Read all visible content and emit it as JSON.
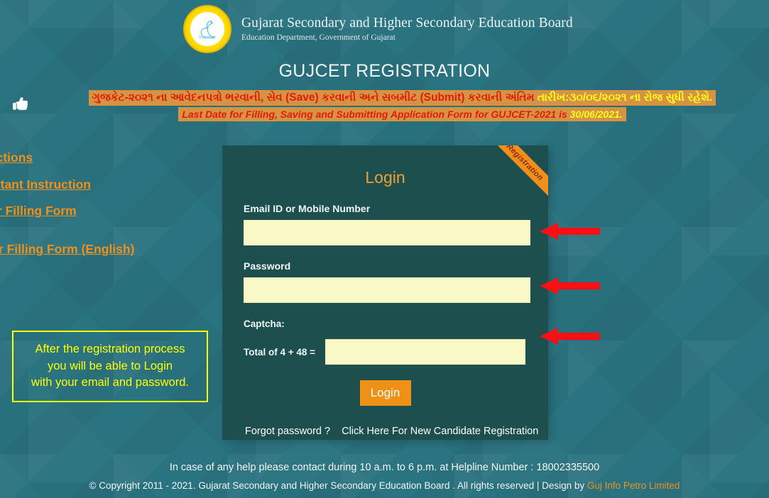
{
  "header": {
    "logo_alt": "gseb-emblem",
    "title": "Gujarat Secondary and Higher Secondary Education Board",
    "subtitle": "Education Department, Government of Gujarat"
  },
  "page_title": "GUJCET REGISTRATION",
  "notice": {
    "hand_icon": "pointing-hand-icon",
    "line1_red": "ગુજકેટ-૨૦૨૧ ના આવેદનપત્રો ભરવાની, સેવ (Save) કરવાની અને સબમીટ (Submit) કરવાની અંતિમ ",
    "line1_yellow": "તારીખ:૩૦/૦૬/૨૦૨૧ ના રોજ સુધી રહેશે.",
    "line2_red": "Last Date for Filling, Saving and Submitting Application Form for GUJCET-2021 is ",
    "line2_yellow": "30/06/2021."
  },
  "side_links": [
    {
      "label": "Instructions"
    },
    {
      "label": "Important Instruction"
    },
    {
      "label": "Steps For Filling Form"
    },
    {
      "label": "Steps For Filling Form (English)"
    }
  ],
  "note_box": {
    "line1": "After the registration process",
    "line2": "you will be able to Login",
    "line3": "with your email and password."
  },
  "login": {
    "ribbon": "Registration",
    "title": "Login",
    "email_label": "Email ID or Mobile Number",
    "email_value": "",
    "email_placeholder": "",
    "password_label": "Password",
    "password_value": "",
    "password_placeholder": "",
    "captcha_label": "Captcha:",
    "captcha_question": "Total of 4 + 48 =",
    "captcha_value": "",
    "captcha_placeholder": "",
    "login_button": "Login",
    "forgot_password": "Forgot password ?",
    "new_registration": "Click Here For New Candidate Registration"
  },
  "arrows": {
    "icon": "left-arrow-icon",
    "color": "#fa0f14"
  },
  "footer": {
    "help": "In case of any help please contact during 10 a.m. to 6 p.m. at Helpline Number : 18002335500",
    "copyright": "© Copyright 2011 - 2021. Gujarat Secondary and Higher Secondary Education Board . All rights reserved | Design by ",
    "vendor": "Guj Info Petro Limited"
  },
  "colors": {
    "page_bg": "#2a7380",
    "panel_bg": "#1d4f4f",
    "accent_orange": "#f0901a",
    "notice_bg": "#d79341",
    "notice_red": "#e21b0c",
    "notice_yellow": "#ffff1e",
    "input_bg": "#f9f9c7",
    "arrow_red": "#fa0f14",
    "note_yellow": "#ffff00"
  }
}
